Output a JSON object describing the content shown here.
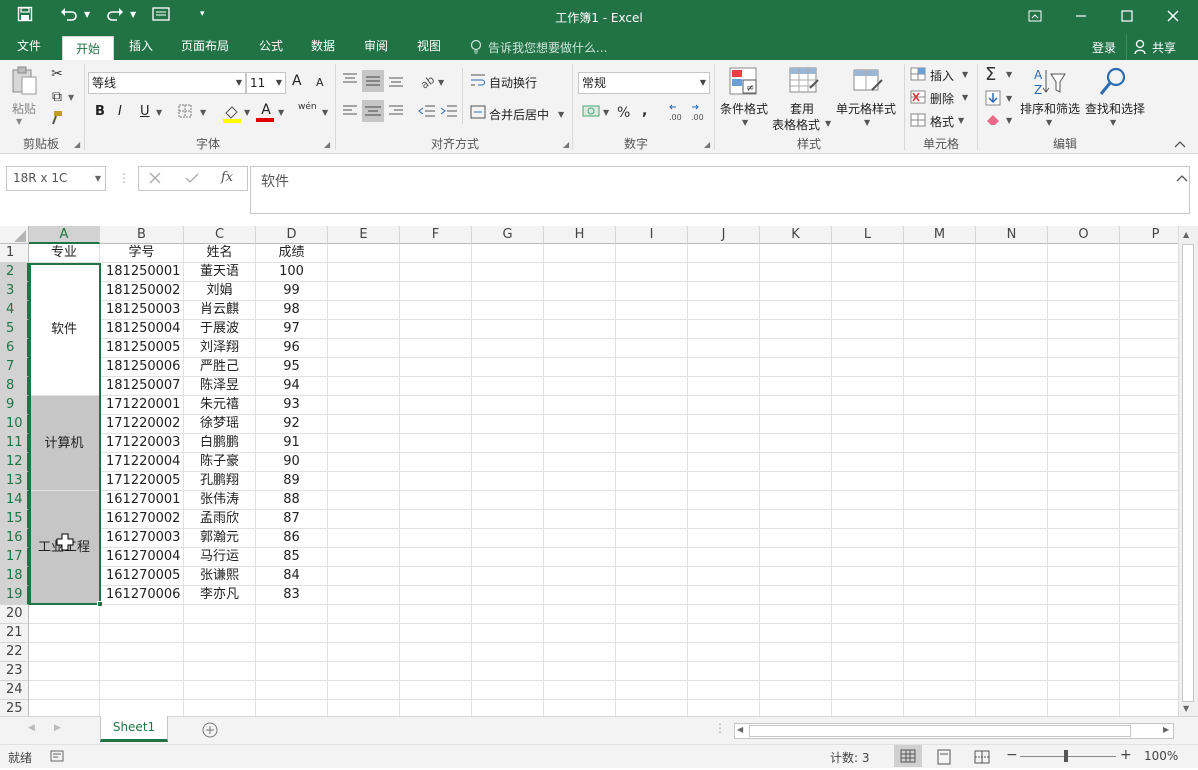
{
  "window": {
    "title": "工作簿1 - Excel"
  },
  "tabs": [
    "文件",
    "开始",
    "插入",
    "页面布局",
    "公式",
    "数据",
    "审阅",
    "视图"
  ],
  "active_tab": "开始",
  "tell_me": "告诉我您想要做什么...",
  "account": {
    "login": "登录",
    "share": "共享"
  },
  "ribbon": {
    "clipboard": {
      "paste": "粘贴",
      "label": "剪贴板"
    },
    "font": {
      "name": "等线",
      "size": "11",
      "label": "字体",
      "bold": "B",
      "italic": "I",
      "underline": "U",
      "grow": "A",
      "shrink": "A",
      "font_color_glyph": "A",
      "phonetic": "wén"
    },
    "alignment": {
      "wrap": "自动换行",
      "merge": "合并后居中",
      "label": "对齐方式"
    },
    "number": {
      "format": "常规",
      "label": "数字",
      "percent": "%",
      "comma": ","
    },
    "styles": {
      "conditional": "条件格式",
      "table_line1": "套用",
      "table_line2": "表格格式",
      "cell_styles": "单元格样式",
      "label": "样式"
    },
    "cells": {
      "insert": "插入",
      "delete": "删除",
      "format": "格式",
      "label": "单元格"
    },
    "editing": {
      "sort": "排序和筛选",
      "find": "查找和选择",
      "label": "编辑"
    }
  },
  "formula_bar": {
    "name_box": "18R x 1C",
    "fx": "fx",
    "content": "软件"
  },
  "columns": [
    "A",
    "B",
    "C",
    "D",
    "E",
    "F",
    "G",
    "H",
    "I",
    "J",
    "K",
    "L",
    "M",
    "N",
    "O",
    "P"
  ],
  "rows": [
    "1",
    "2",
    "3",
    "4",
    "5",
    "6",
    "7",
    "8",
    "9",
    "10",
    "11",
    "12",
    "13",
    "14",
    "15",
    "16",
    "17",
    "18",
    "19",
    "20",
    "21",
    "22",
    "23",
    "24",
    "25"
  ],
  "header_row": [
    "专业",
    "学号",
    "姓名",
    "成绩"
  ],
  "merged_groups": [
    "软件",
    "计算机",
    "工业工程"
  ],
  "records": [
    [
      "181250001",
      "董天语",
      "100"
    ],
    [
      "181250002",
      "刘娟",
      "99"
    ],
    [
      "181250003",
      "肖云麒",
      "98"
    ],
    [
      "181250004",
      "于展波",
      "97"
    ],
    [
      "181250005",
      "刘泽翔",
      "96"
    ],
    [
      "181250006",
      "严胜己",
      "95"
    ],
    [
      "181250007",
      "陈泽昱",
      "94"
    ],
    [
      "171220001",
      "朱元禧",
      "93"
    ],
    [
      "171220002",
      "徐梦瑶",
      "92"
    ],
    [
      "171220003",
      "白鹏鹏",
      "91"
    ],
    [
      "171220004",
      "陈子豪",
      "90"
    ],
    [
      "171220005",
      "孔鹏翔",
      "89"
    ],
    [
      "161270001",
      "张伟涛",
      "88"
    ],
    [
      "161270002",
      "孟雨欣",
      "87"
    ],
    [
      "161270003",
      "郭瀚元",
      "86"
    ],
    [
      "161270004",
      "马行运",
      "85"
    ],
    [
      "161270005",
      "张谦熙",
      "84"
    ],
    [
      "161270006",
      "李亦凡",
      "83"
    ]
  ],
  "sheet_tab": "Sheet1",
  "status": {
    "ready": "就绪",
    "count": "计数: 3",
    "zoom": "100%"
  },
  "colors": {
    "accent": "#217346",
    "selection_fill": "#c6c6c6"
  }
}
